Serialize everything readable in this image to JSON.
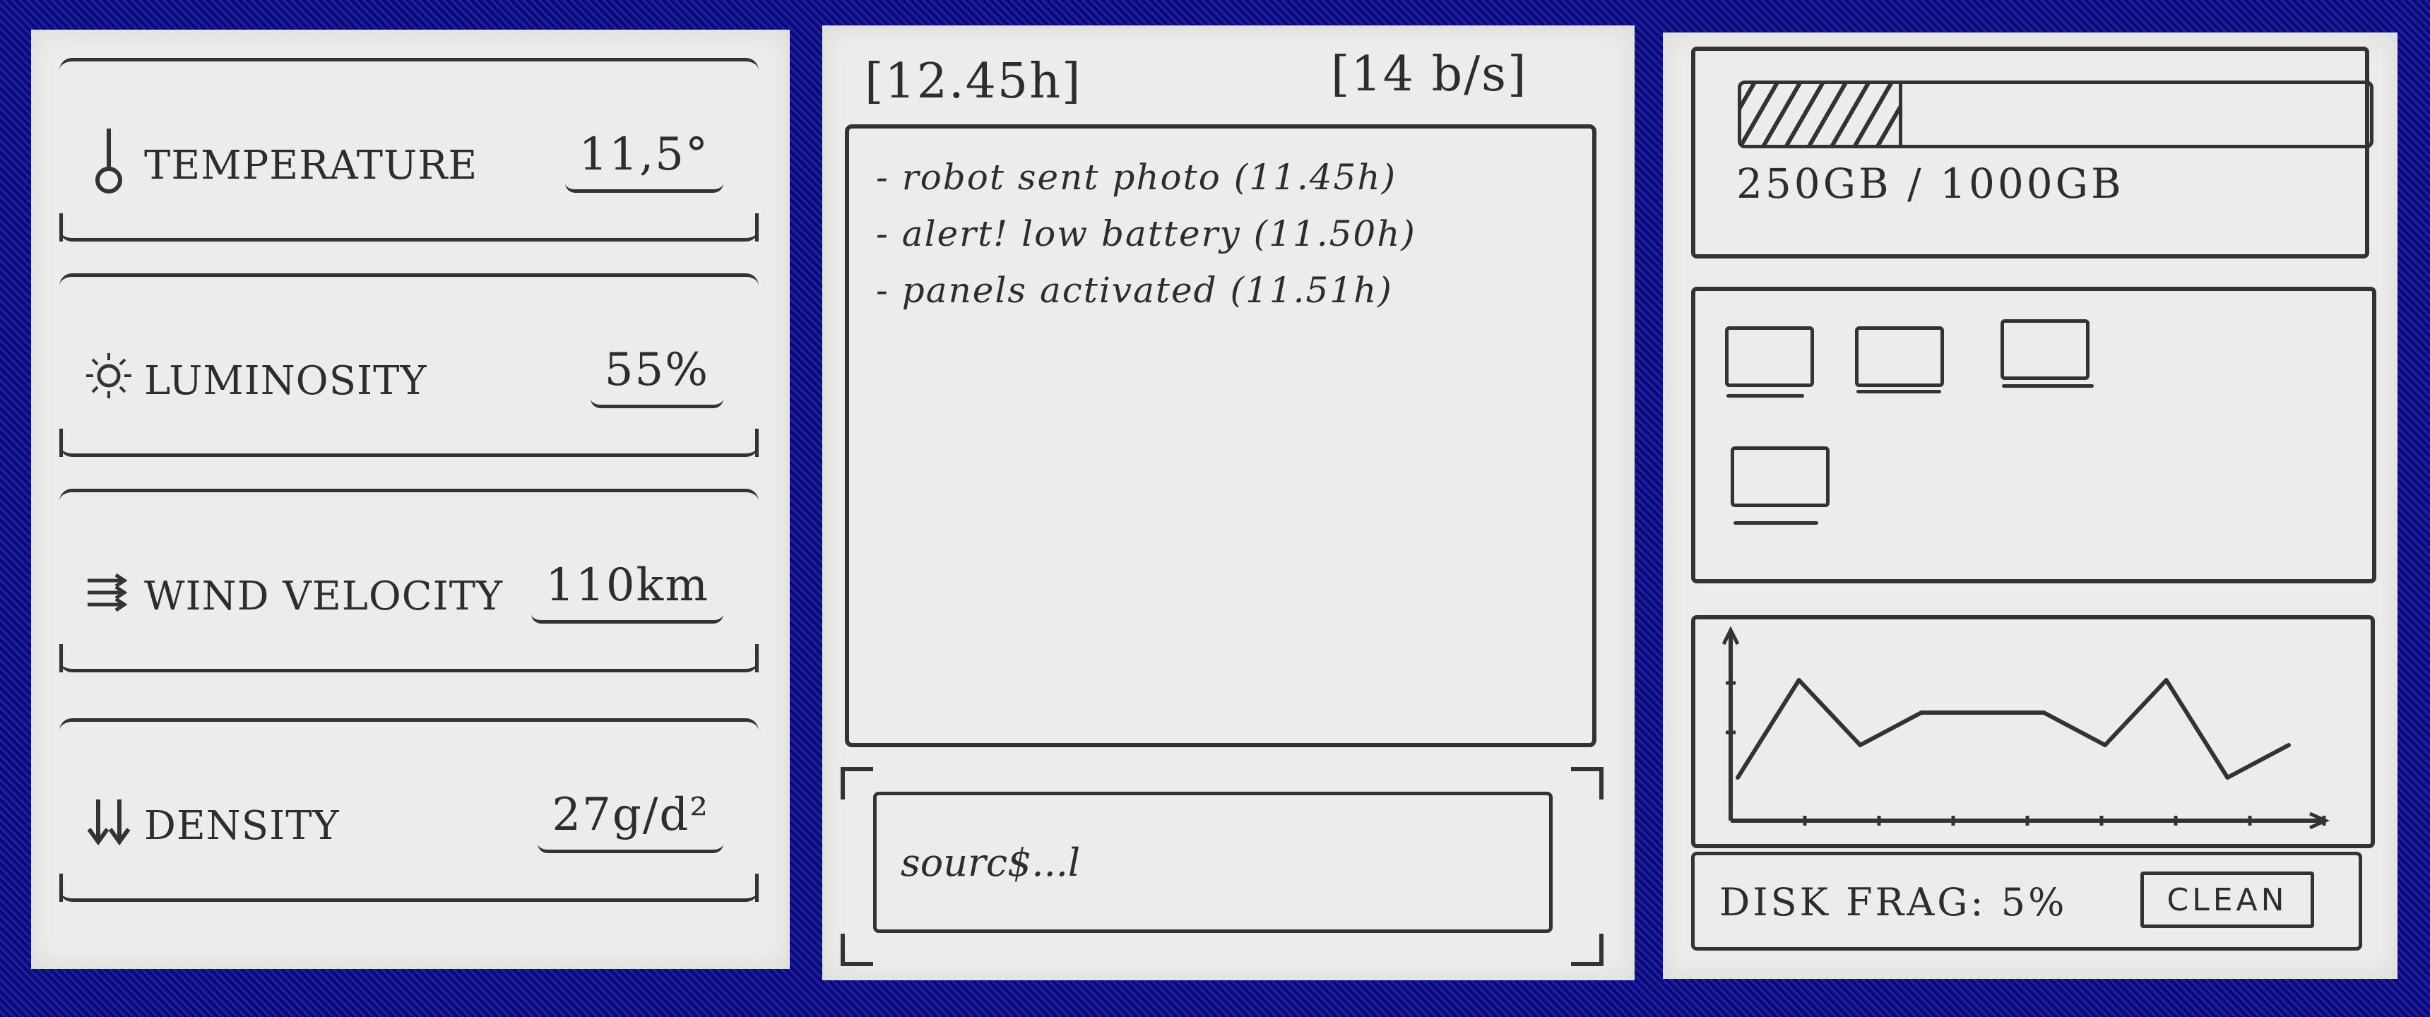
{
  "sensors": [
    {
      "icon": "thermometer-icon",
      "label": "TEMPERATURE",
      "value": "11,5°"
    },
    {
      "icon": "sun-icon",
      "label": "LUMINOSITY",
      "value": "55%"
    },
    {
      "icon": "wind-icon",
      "label": "WIND VELOCITY",
      "value": "110km"
    },
    {
      "icon": "down-arrows-icon",
      "label": "DENSITY",
      "value": "27g/d²"
    }
  ],
  "log_panel": {
    "time": "[12.45h]",
    "rate": "[14 b/s]",
    "entries": [
      "- robot sent photo (11.45h)",
      "- alert! low battery (11.50h)",
      "- panels activated (11.51h)"
    ],
    "input_value": "sourc$...l"
  },
  "system_panel": {
    "storage_text": "250GB / 1000GB",
    "storage_used_fraction": 0.25,
    "chart_data": {
      "type": "line",
      "x": [
        0,
        1,
        2,
        3,
        4,
        5,
        6,
        7,
        8
      ],
      "values": [
        2,
        5,
        3,
        4,
        4,
        4,
        3,
        5,
        2,
        3
      ],
      "title": "",
      "xlabel": "",
      "ylabel": ""
    },
    "frag_text": "DISK FRAG: 5%",
    "clean_label": "CLEAN"
  }
}
